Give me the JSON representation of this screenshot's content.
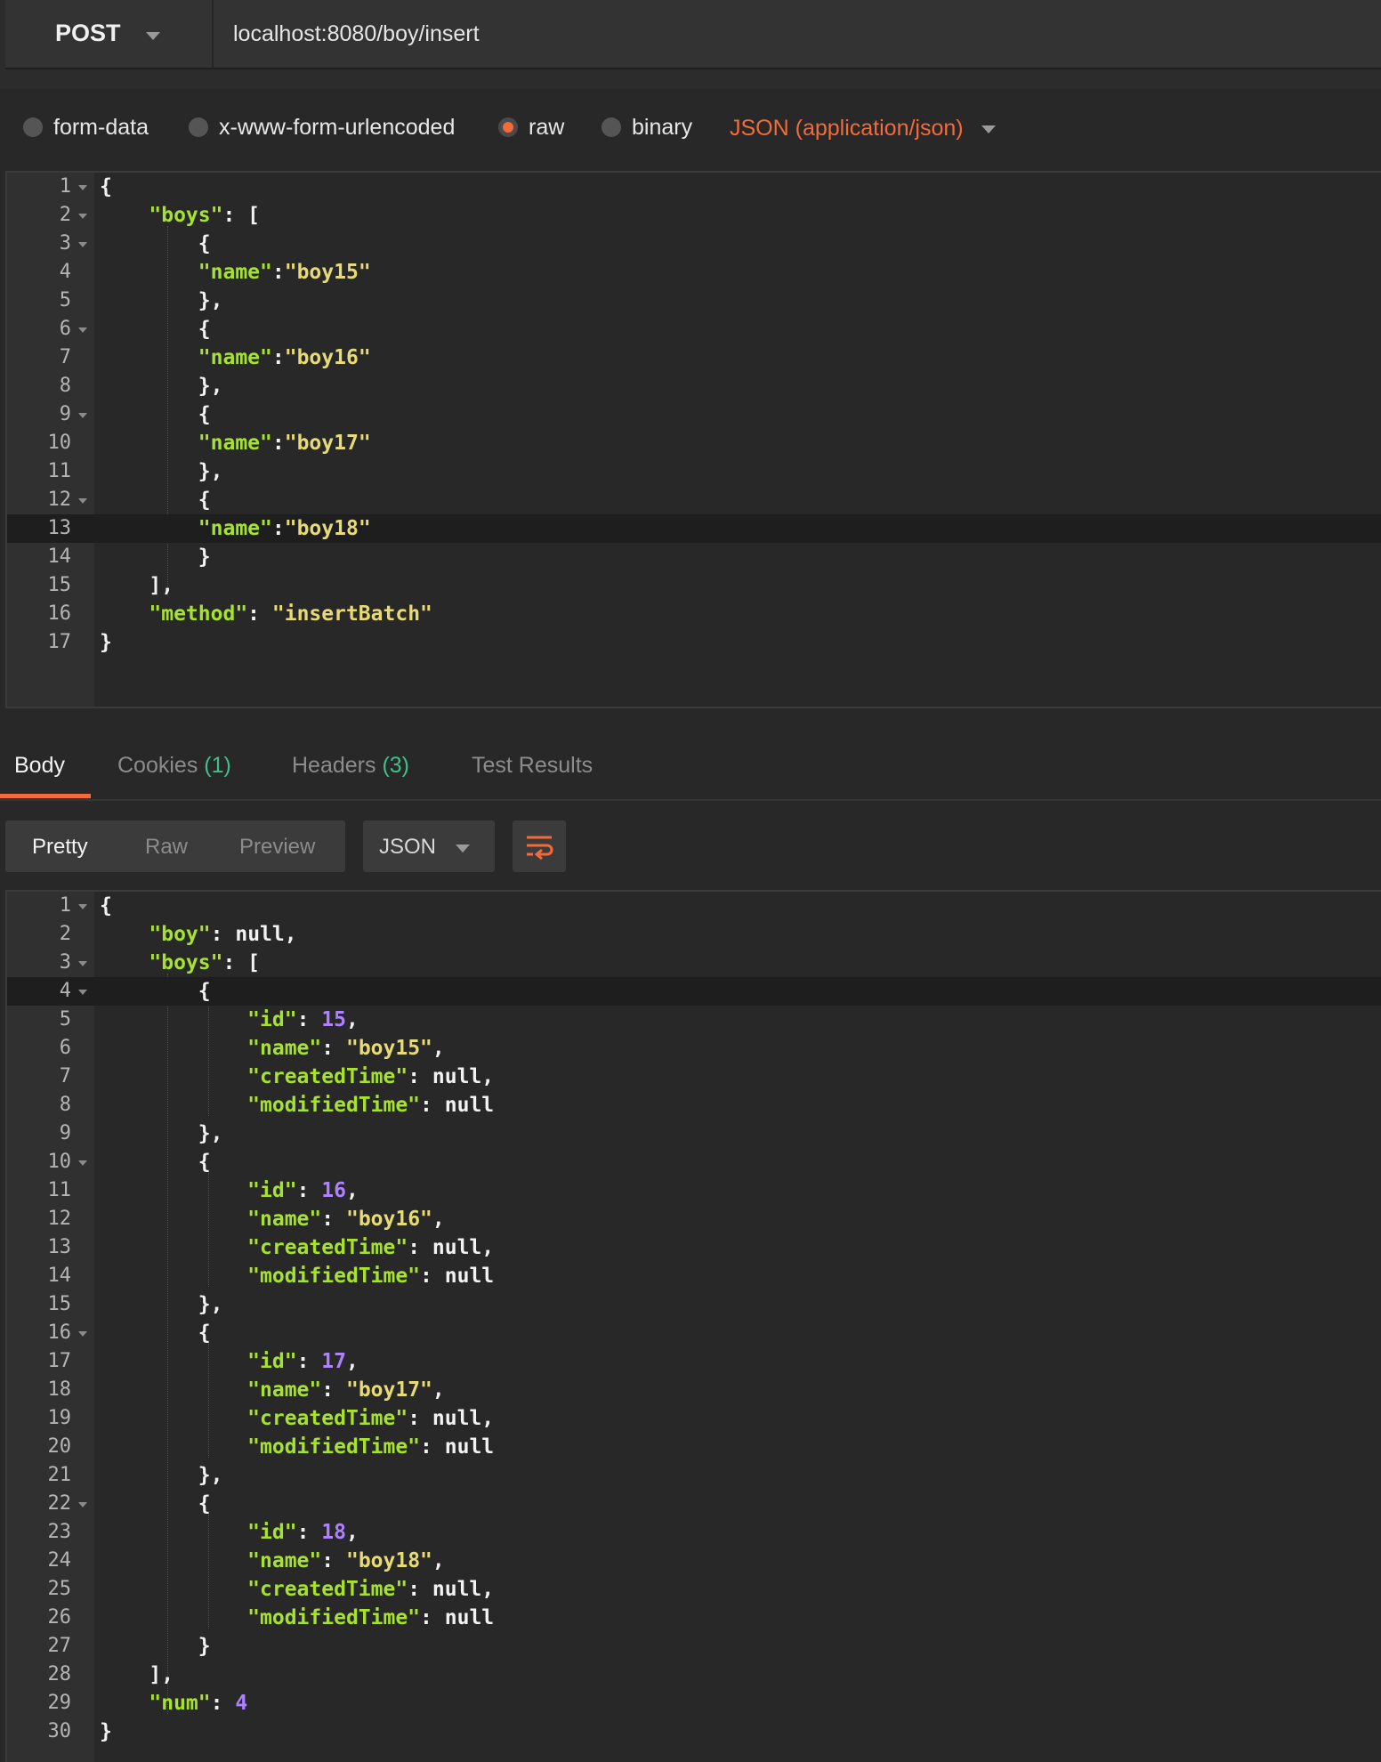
{
  "request": {
    "method": "POST",
    "url": "localhost:8080/boy/insert"
  },
  "body_options": {
    "items": [
      {
        "label": "form-data",
        "selected": false
      },
      {
        "label": "x-www-form-urlencoded",
        "selected": false
      },
      {
        "label": "raw",
        "selected": true
      },
      {
        "label": "binary",
        "selected": false
      }
    ],
    "content_type": "JSON (application/json)"
  },
  "request_body": {
    "line_numbers": [
      "1",
      "2",
      "3",
      "4",
      "5",
      "6",
      "7",
      "8",
      "9",
      "10",
      "11",
      "12",
      "13",
      "14",
      "15",
      "16",
      "17"
    ],
    "text": {
      "boys_key": "\"boys\"",
      "name_key": "\"name\"",
      "boy15": "\"boy15\"",
      "boy16": "\"boy16\"",
      "boy17": "\"boy17\"",
      "boy18": "\"boy18\"",
      "method_key": "\"method\"",
      "method_value": "\"insertBatch\""
    }
  },
  "response": {
    "tabs": [
      {
        "label": "Body",
        "count": ""
      },
      {
        "label": "Cookies",
        "count": "(1)"
      },
      {
        "label": "Headers",
        "count": "(3)"
      },
      {
        "label": "Test Results",
        "count": ""
      }
    ],
    "view_modes": [
      "Pretty",
      "Raw",
      "Preview"
    ],
    "format": "JSON",
    "line_numbers": [
      "1",
      "2",
      "3",
      "4",
      "5",
      "6",
      "7",
      "8",
      "9",
      "10",
      "11",
      "12",
      "13",
      "14",
      "15",
      "16",
      "17",
      "18",
      "19",
      "20",
      "21",
      "22",
      "23",
      "24",
      "25",
      "26",
      "27",
      "28",
      "29",
      "30"
    ],
    "text": {
      "boy_key": "\"boy\"",
      "boys_key": "\"boys\"",
      "id_key": "\"id\"",
      "name_key": "\"name\"",
      "created_key": "\"createdTime\"",
      "modified_key": "\"modifiedTime\"",
      "null": "null",
      "num_key": "\"num\"",
      "num_value": "4",
      "ids": [
        "15",
        "16",
        "17",
        "18"
      ],
      "names": [
        "\"boy15\"",
        "\"boy16\"",
        "\"boy17\"",
        "\"boy18\""
      ]
    }
  },
  "colors": {
    "accent": "#f26b3a",
    "key": "#a6e22e",
    "string": "#e6db74",
    "number": "#ae81ff",
    "count": "#3fbf8a"
  }
}
